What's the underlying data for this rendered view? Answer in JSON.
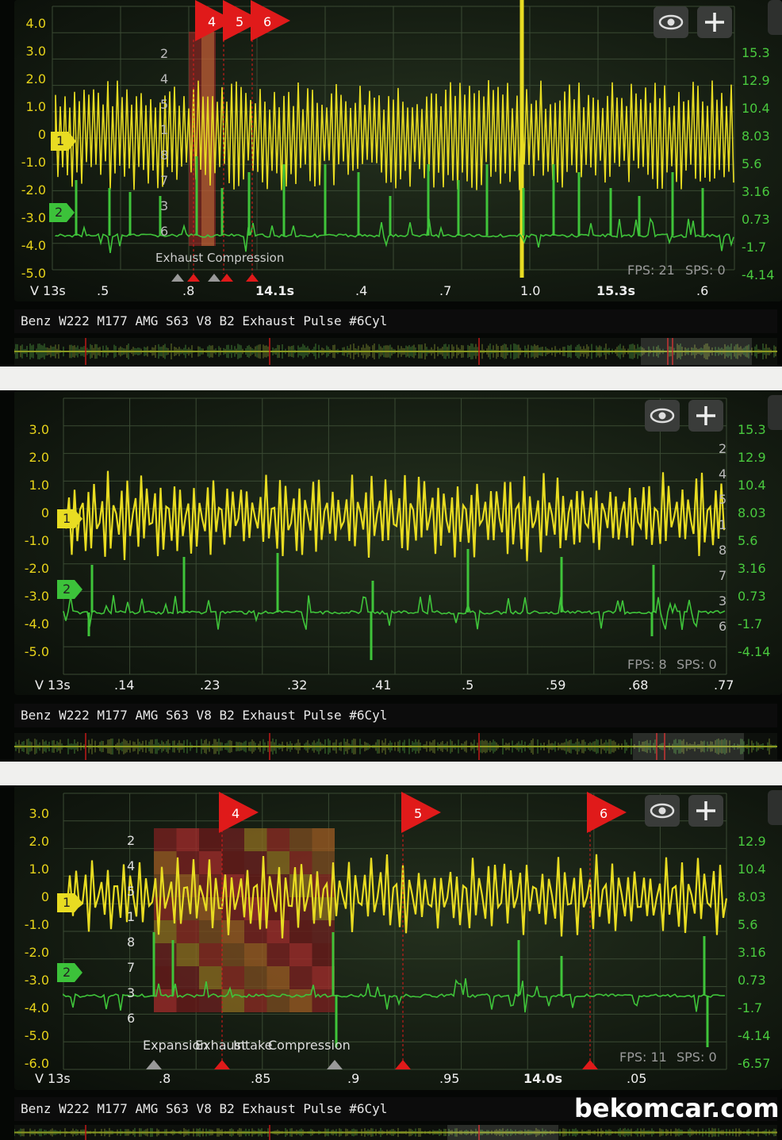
{
  "panels": [
    {
      "title": "Benz W222 M177 AMG S63 V8 B2 Exhaust Pulse #6Cyl",
      "y_left": [
        "4.0",
        "3.0",
        "2.0",
        "1.0",
        "0",
        "-1.0",
        "-2.0",
        "-3.0",
        "-4.0",
        "-5.0"
      ],
      "y_right": [
        "15.3",
        "12.9",
        "10.4",
        "8.03",
        "5.6",
        "3.16",
        "0.73",
        "-1.7",
        "-4.14"
      ],
      "x_ticks": [
        ".5",
        ".8",
        "14.1s",
        ".4",
        ".7",
        "1.0",
        "15.3s",
        ".6"
      ],
      "x_unit": "V 13s",
      "fps": "FPS: 21",
      "sps": "SPS: 0",
      "channel_1": "1",
      "channel_2": "2",
      "cursors": [
        "4",
        "5",
        "6"
      ],
      "cyl_order": [
        "2",
        "4",
        "5",
        "1",
        "8",
        "7",
        "3",
        "6"
      ],
      "phase_label": "Exhaust Compression"
    },
    {
      "title": "Benz W222 M177 AMG S63 V8 B2 Exhaust Pulse #6Cyl",
      "y_left": [
        "3.0",
        "2.0",
        "1.0",
        "0",
        "-1.0",
        "-2.0",
        "-3.0",
        "-4.0",
        "-5.0"
      ],
      "y_right": [
        "15.3",
        "12.9",
        "10.4",
        "8.03",
        "5.6",
        "3.16",
        "0.73",
        "-1.7",
        "-4.14"
      ],
      "x_ticks": [
        ".14",
        ".23",
        ".32",
        ".41",
        ".5",
        ".59",
        ".68",
        ".77"
      ],
      "x_unit": "V 13s",
      "fps": "FPS: 8",
      "sps": "SPS: 0",
      "channel_1": "1",
      "channel_2": "2",
      "cyl_order": [
        "2",
        "4",
        "5",
        "1",
        "8",
        "7",
        "3",
        "6"
      ]
    },
    {
      "title": "Benz W222 M177 AMG S63 V8 B2 Exhaust Pulse #6Cyl",
      "y_left": [
        "3.0",
        "2.0",
        "1.0",
        "0",
        "-1.0",
        "-2.0",
        "-3.0",
        "-4.0",
        "-5.0",
        "-6.0"
      ],
      "y_right": [
        "12.9",
        "10.4",
        "8.03",
        "5.6",
        "3.16",
        "0.73",
        "-1.7",
        "-4.14",
        "-6.57"
      ],
      "x_ticks": [
        ".8",
        ".85",
        ".9",
        ".95",
        "14.0s",
        ".05"
      ],
      "x_unit": "V 13s",
      "fps": "FPS: 11",
      "sps": "SPS: 0",
      "channel_1": "1",
      "channel_2": "2",
      "cursors": [
        "4",
        "5",
        "6"
      ],
      "cyl_order": [
        "2",
        "4",
        "5",
        "1",
        "8",
        "7",
        "3",
        "6"
      ],
      "phases": [
        "Expansion",
        "Exhaust",
        "Intake",
        "Compression"
      ]
    }
  ],
  "watermark": "bekomcar.com",
  "colors": {
    "yellow": "#e8dc22",
    "green": "#3fc43a",
    "red": "#e01a1a",
    "bg": "#141c11"
  }
}
